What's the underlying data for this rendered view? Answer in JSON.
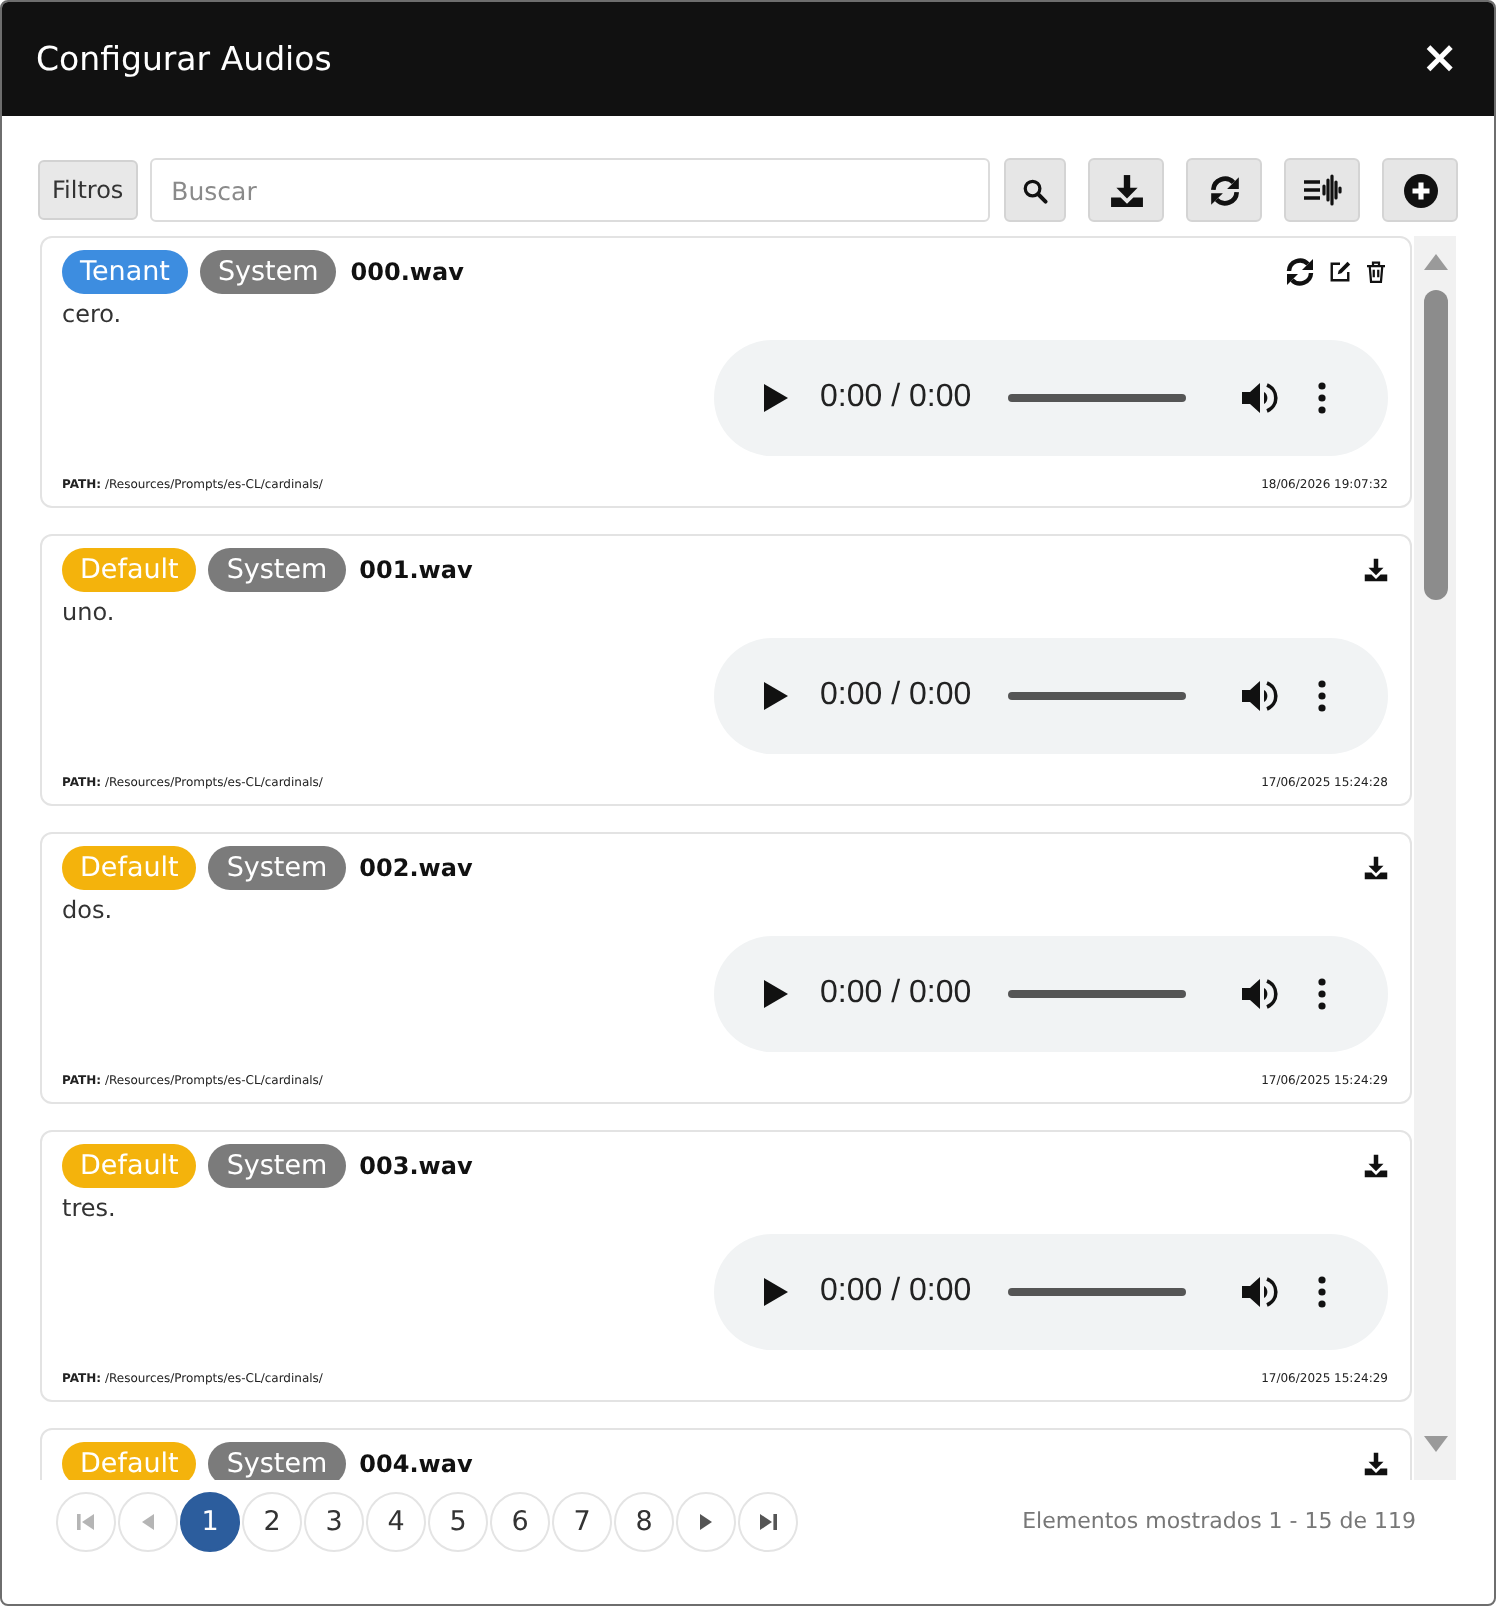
{
  "dialog": {
    "title": "Configurar Audios",
    "close": "×"
  },
  "toolbar": {
    "filter_button": "Filtros",
    "search": {
      "placeholder": "Buscar"
    }
  },
  "audios": [
    {
      "tags": [
        {
          "label": "Tenant",
          "color": "#3d8de0"
        },
        {
          "label": "System",
          "color": "#7b7b7b"
        }
      ],
      "file": "000.wav",
      "editable": true,
      "description": "cero.",
      "player": {
        "time": "0:00 / 0:00",
        "level": 0
      },
      "path": "**PATH:** /Resources/Prompts/es-CL/cardinals/",
      "date": "18/06/2026 19:07:32"
    },
    {
      "tags": [
        {
          "label": "Default",
          "color": "#f4b30c"
        },
        {
          "label": "System",
          "color": "#7b7b7b"
        }
      ],
      "file": "001.wav",
      "editable": false,
      "description": "uno.",
      "player": {
        "time": "0:00 / 0:00",
        "level": 0
      },
      "path": "**PATH:** /Resources/Prompts/es-CL/cardinals/",
      "date": "17/06/2025 15:24:28"
    },
    {
      "tags": [
        {
          "label": "Default",
          "color": "#f4b30c"
        },
        {
          "label": "System",
          "color": "#7b7b7b"
        }
      ],
      "file": "002.wav",
      "editable": false,
      "description": "dos.",
      "player": {
        "time": "0:00 / 0:00",
        "level": 0
      },
      "path": "**PATH:** /Resources/Prompts/es-CL/cardinals/",
      "date": "17/06/2025 15:24:29"
    },
    {
      "tags": [
        {
          "label": "Default",
          "color": "#f4b30c"
        },
        {
          "label": "System",
          "color": "#7b7b7b"
        }
      ],
      "file": "003.wav",
      "editable": false,
      "description": "tres.",
      "player": {
        "time": "0:00 / 0:00",
        "level": 0
      },
      "path": "**PATH:** /Resources/Prompts/es-CL/cardinals/",
      "date": "17/06/2025 15:24:29"
    },
    {
      "tags": [
        {
          "label": "Default",
          "color": "#f4b30c"
        },
        {
          "label": "System",
          "color": "#7b7b7b"
        }
      ],
      "file": "004.wav",
      "editable": false
    }
  ],
  "pagination": {
    "controls": [
      {
        "kind": "first",
        "disabled": true
      },
      {
        "kind": "previous",
        "disabled": true
      },
      {
        "kind": "page",
        "label": "1",
        "selected": true
      },
      {
        "kind": "page",
        "label": "2",
        "selected": false
      },
      {
        "kind": "page",
        "label": "3",
        "selected": false
      },
      {
        "kind": "page",
        "label": "4",
        "selected": false
      },
      {
        "kind": "page",
        "label": "5",
        "selected": false
      },
      {
        "kind": "page",
        "label": "6",
        "selected": false
      },
      {
        "kind": "page",
        "label": "7",
        "selected": false
      },
      {
        "kind": "page",
        "label": "8",
        "selected": false
      },
      {
        "kind": "next",
        "disabled": false
      },
      {
        "kind": "last",
        "disabled": false
      }
    ],
    "summary": "Elementos mostrados 1 - 15 de 119"
  }
}
